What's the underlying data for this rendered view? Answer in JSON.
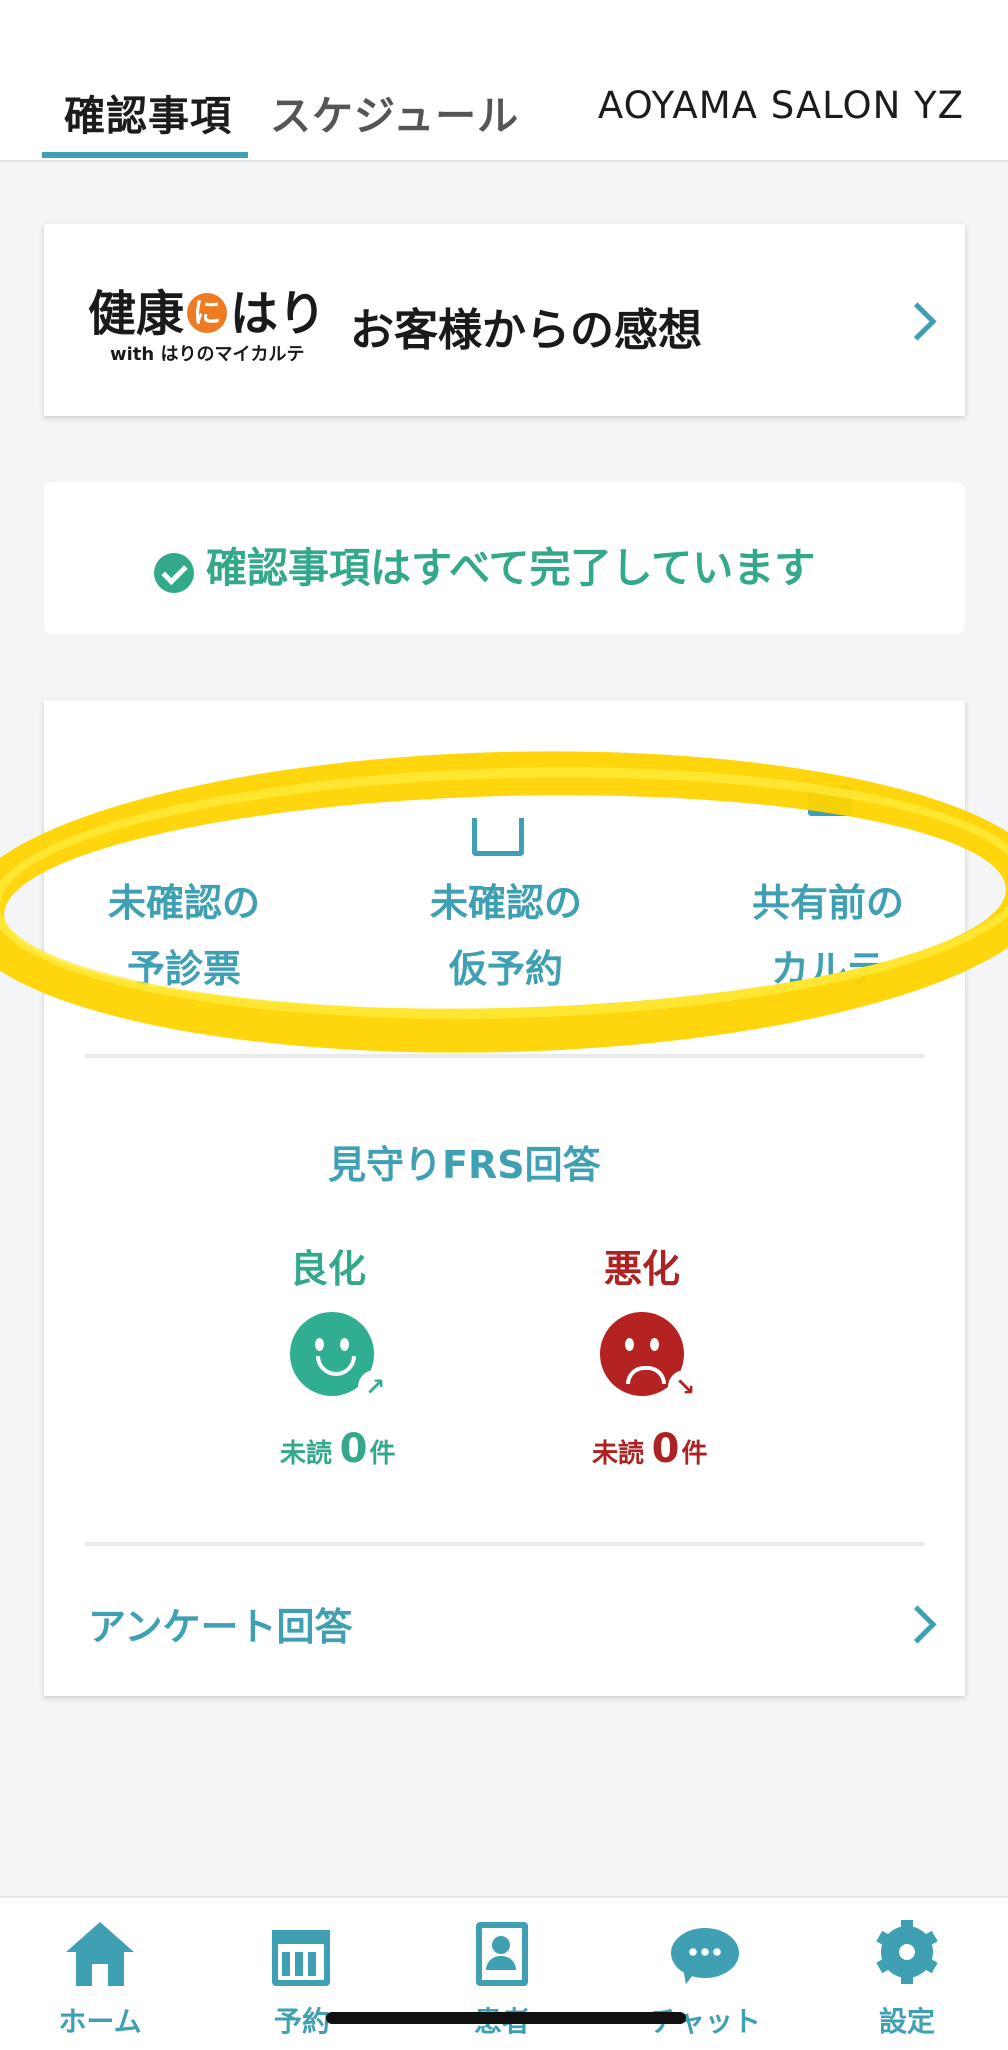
{
  "header": {
    "tabs": [
      {
        "label": "確認事項",
        "active": true
      },
      {
        "label": "スケジュール",
        "active": false
      }
    ],
    "salon_name": "AOYAMA SALON YZ"
  },
  "banner": {
    "logo_main_pre": "健康",
    "logo_main_mid": "に",
    "logo_main_post": "はり",
    "logo_sub": "with はりのマイカルテ",
    "title": "お客様からの感想"
  },
  "status": {
    "text": "確認事項はすべて完了しています",
    "icon": "check-circle-icon"
  },
  "confirm_tiles": [
    {
      "line1": "未確認の",
      "line2": "予診票"
    },
    {
      "line1": "未確認の",
      "line2": "仮予約"
    },
    {
      "line1": "共有前の",
      "line2": "カルテ"
    }
  ],
  "frs": {
    "title": "見守りFRS回答",
    "good": {
      "label": "良化",
      "unread_prefix": "未読",
      "count": "0",
      "unit": "件"
    },
    "bad": {
      "label": "悪化",
      "unread_prefix": "未読",
      "count": "0",
      "unit": "件"
    }
  },
  "survey": {
    "label": "アンケート回答"
  },
  "bottom_nav": [
    {
      "label": "ホーム",
      "icon": "home-icon"
    },
    {
      "label": "予約",
      "icon": "calendar-icon"
    },
    {
      "label": "患者",
      "icon": "contact-book-icon"
    },
    {
      "label": "チャット",
      "icon": "chat-bubble-icon"
    },
    {
      "label": "設定",
      "icon": "gear-icon"
    }
  ],
  "colors": {
    "accent": "#3f9fb3",
    "success": "#33a88b",
    "danger": "#ad2222",
    "highlight": "#ffd400"
  }
}
